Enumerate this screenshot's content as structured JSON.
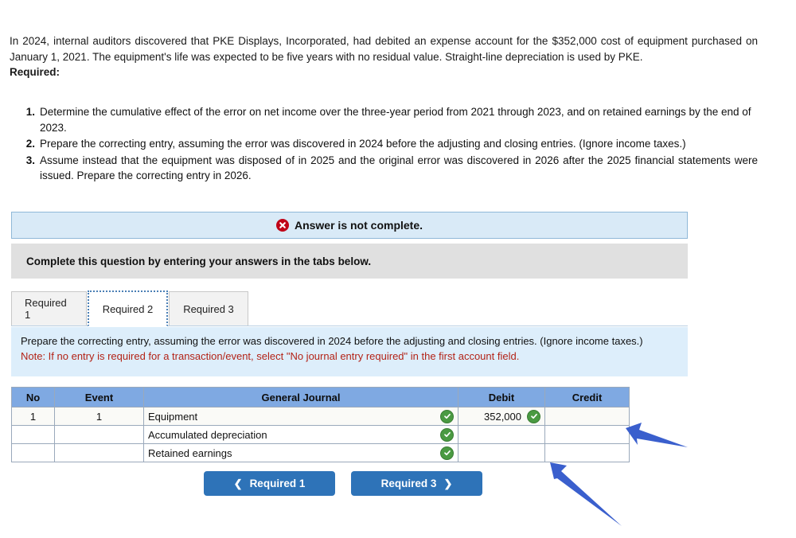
{
  "question": {
    "intro_paragraph": "In 2024, internal auditors discovered that PKE Displays, Incorporated, had debited an expense account for the $352,000 cost of equipment purchased on January 1, 2021. The equipment's life was expected to be five years with no residual value. Straight-line depreciation is used by PKE.",
    "required_label": "Required:",
    "requirements": [
      {
        "number": "1.",
        "text": "Determine the cumulative effect of the error on net income over the three-year period from 2021 through 2023, and on retained earnings by the end of 2023."
      },
      {
        "number": "2.",
        "text": "Prepare the correcting entry, assuming the error was discovered in 2024 before the adjusting and closing entries. (Ignore income taxes.)"
      },
      {
        "number": "3.",
        "text": "Assume instead that the equipment was disposed of in 2025 and the original error was discovered in 2026 after the 2025 financial statements were issued. Prepare the correcting entry in 2026."
      }
    ]
  },
  "alert": {
    "icon": "error-circle-x-icon",
    "text": "Answer is not complete.",
    "background_color": "#d9eaf7",
    "border_color": "#8fb8d8",
    "icon_color": "#c00418"
  },
  "instruction_bar": {
    "text": "Complete this question by entering your answers in the tabs below.",
    "background_color": "#e0e0e0"
  },
  "tabs": {
    "items": [
      {
        "label": "Required 1",
        "active": false
      },
      {
        "label": "Required 2",
        "active": true
      },
      {
        "label": "Required 3",
        "active": false
      }
    ]
  },
  "tab_panel": {
    "description": "Prepare the correcting entry, assuming the error was discovered in 2024 before the adjusting and closing entries. (Ignore income taxes.)",
    "note": "Note: If no entry is required for a transaction/event, select \"No journal entry required\" in the first account field.",
    "note_color": "#b32317",
    "background_color": "#ddeefb"
  },
  "journal_table": {
    "header_color": "#7fa9e2",
    "columns": [
      "No",
      "Event",
      "General Journal",
      "Debit",
      "Credit"
    ],
    "rows": [
      {
        "no": "1",
        "event": "1",
        "general_journal": "Equipment",
        "gj_status": "valid-check-icon",
        "debit": "352,000",
        "debit_status": "valid-check-icon",
        "credit": ""
      },
      {
        "no": "",
        "event": "",
        "general_journal": "Accumulated depreciation",
        "gj_status": "valid-check-icon",
        "debit": "",
        "debit_status": "",
        "credit": ""
      },
      {
        "no": "",
        "event": "",
        "general_journal": "Retained earnings",
        "gj_status": "valid-check-icon",
        "debit": "",
        "debit_status": "",
        "credit": ""
      }
    ]
  },
  "navigation": {
    "prev_label": "Required 1",
    "next_label": "Required 3",
    "prev_icon": "chevron-left-icon",
    "next_icon": "chevron-right-icon",
    "button_color": "#2e73b8"
  },
  "annotations": {
    "arrow_color": "#3a5fcd",
    "arrows": [
      {
        "name": "annotation-arrow-credit-row-2"
      },
      {
        "name": "annotation-arrow-credit-row-3"
      }
    ]
  }
}
